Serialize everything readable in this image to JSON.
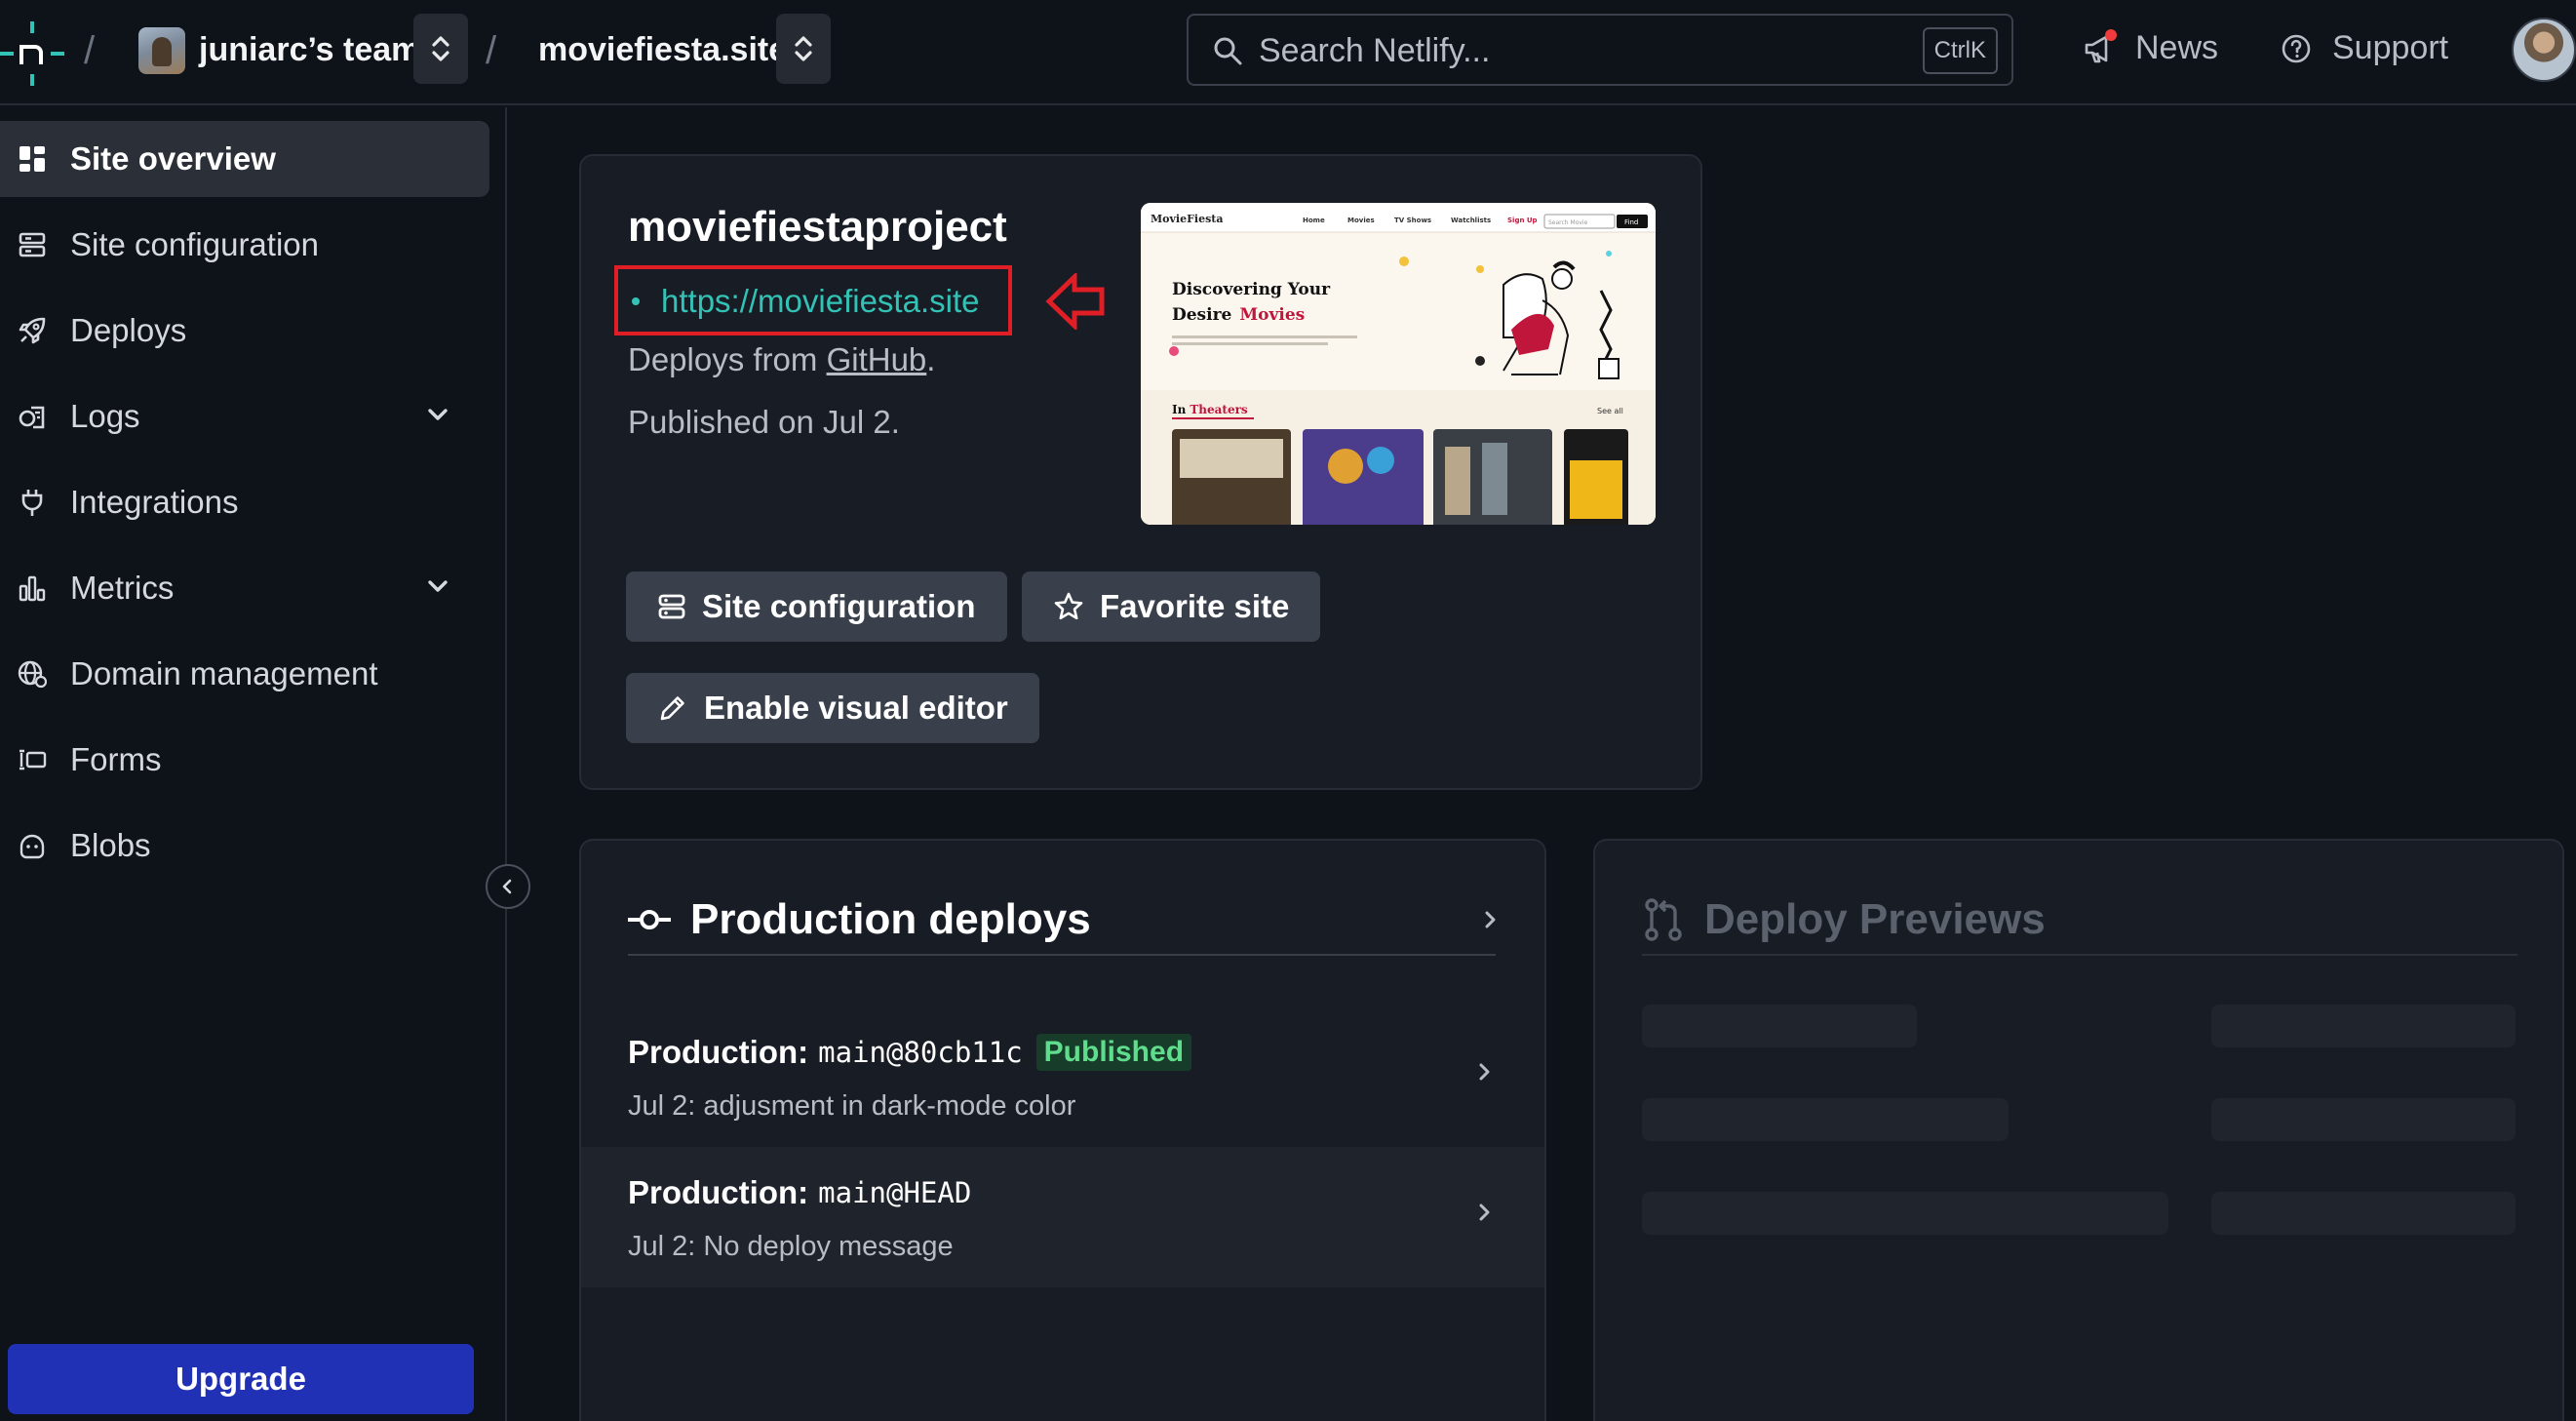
{
  "topbar": {
    "team_name": "juniarc’s team",
    "site_name": "moviefiesta.site",
    "search_placeholder": "Search Netlify...",
    "search_shortcut": "CtrlK",
    "news_label": "News",
    "support_label": "Support"
  },
  "sidebar": {
    "items": [
      {
        "label": "Site overview",
        "icon": "grid-icon",
        "active": true
      },
      {
        "label": "Site configuration",
        "icon": "server-icon"
      },
      {
        "label": "Deploys",
        "icon": "rocket-icon"
      },
      {
        "label": "Logs",
        "icon": "logs-icon",
        "expandable": true
      },
      {
        "label": "Integrations",
        "icon": "plug-icon"
      },
      {
        "label": "Metrics",
        "icon": "bar-chart-icon",
        "expandable": true
      },
      {
        "label": "Domain management",
        "icon": "globe-icon"
      },
      {
        "label": "Forms",
        "icon": "form-icon"
      },
      {
        "label": "Blobs",
        "icon": "blob-icon"
      }
    ],
    "upgrade_label": "Upgrade"
  },
  "site_card": {
    "project_name": "moviefiestaproject",
    "url": "https://moviefiesta.site",
    "deploys_from_prefix": "Deploys from ",
    "deploys_from_source": "GitHub",
    "deploys_from_suffix": ".",
    "published": "Published on Jul 2.",
    "buttons": {
      "site_configuration": "Site configuration",
      "favorite_site": "Favorite site",
      "enable_visual_editor": "Enable visual editor"
    },
    "preview": {
      "brand": "MovieFiesta",
      "nav": [
        "Home",
        "Movies",
        "TV Shows",
        "Watchlists",
        "Sign Up"
      ],
      "search_placeholder": "Search Movie",
      "search_button": "Find",
      "hero_line1": "Discovering Your",
      "hero_line2": "Desire",
      "hero_highlight": "Movies",
      "section_prefix": "In",
      "section_highlight": "Theaters",
      "see_all": "See all"
    }
  },
  "production": {
    "title": "Production deploys",
    "rows": [
      {
        "label": "Production:",
        "ref": "main@80cb11c",
        "badge": "Published",
        "message": "Jul 2: adjusment in dark-mode color"
      },
      {
        "label": "Production:",
        "ref": "main@HEAD",
        "badge": "",
        "message": "Jul 2: No deploy message"
      }
    ]
  },
  "previews": {
    "title": "Deploy Previews"
  },
  "colors": {
    "background": "#0e1219",
    "card": "#181c24",
    "accent_teal": "#33c3b6",
    "highlight_red": "#e01e26",
    "upgrade_blue": "#2131b5",
    "published_green": "#5fdc8c"
  }
}
